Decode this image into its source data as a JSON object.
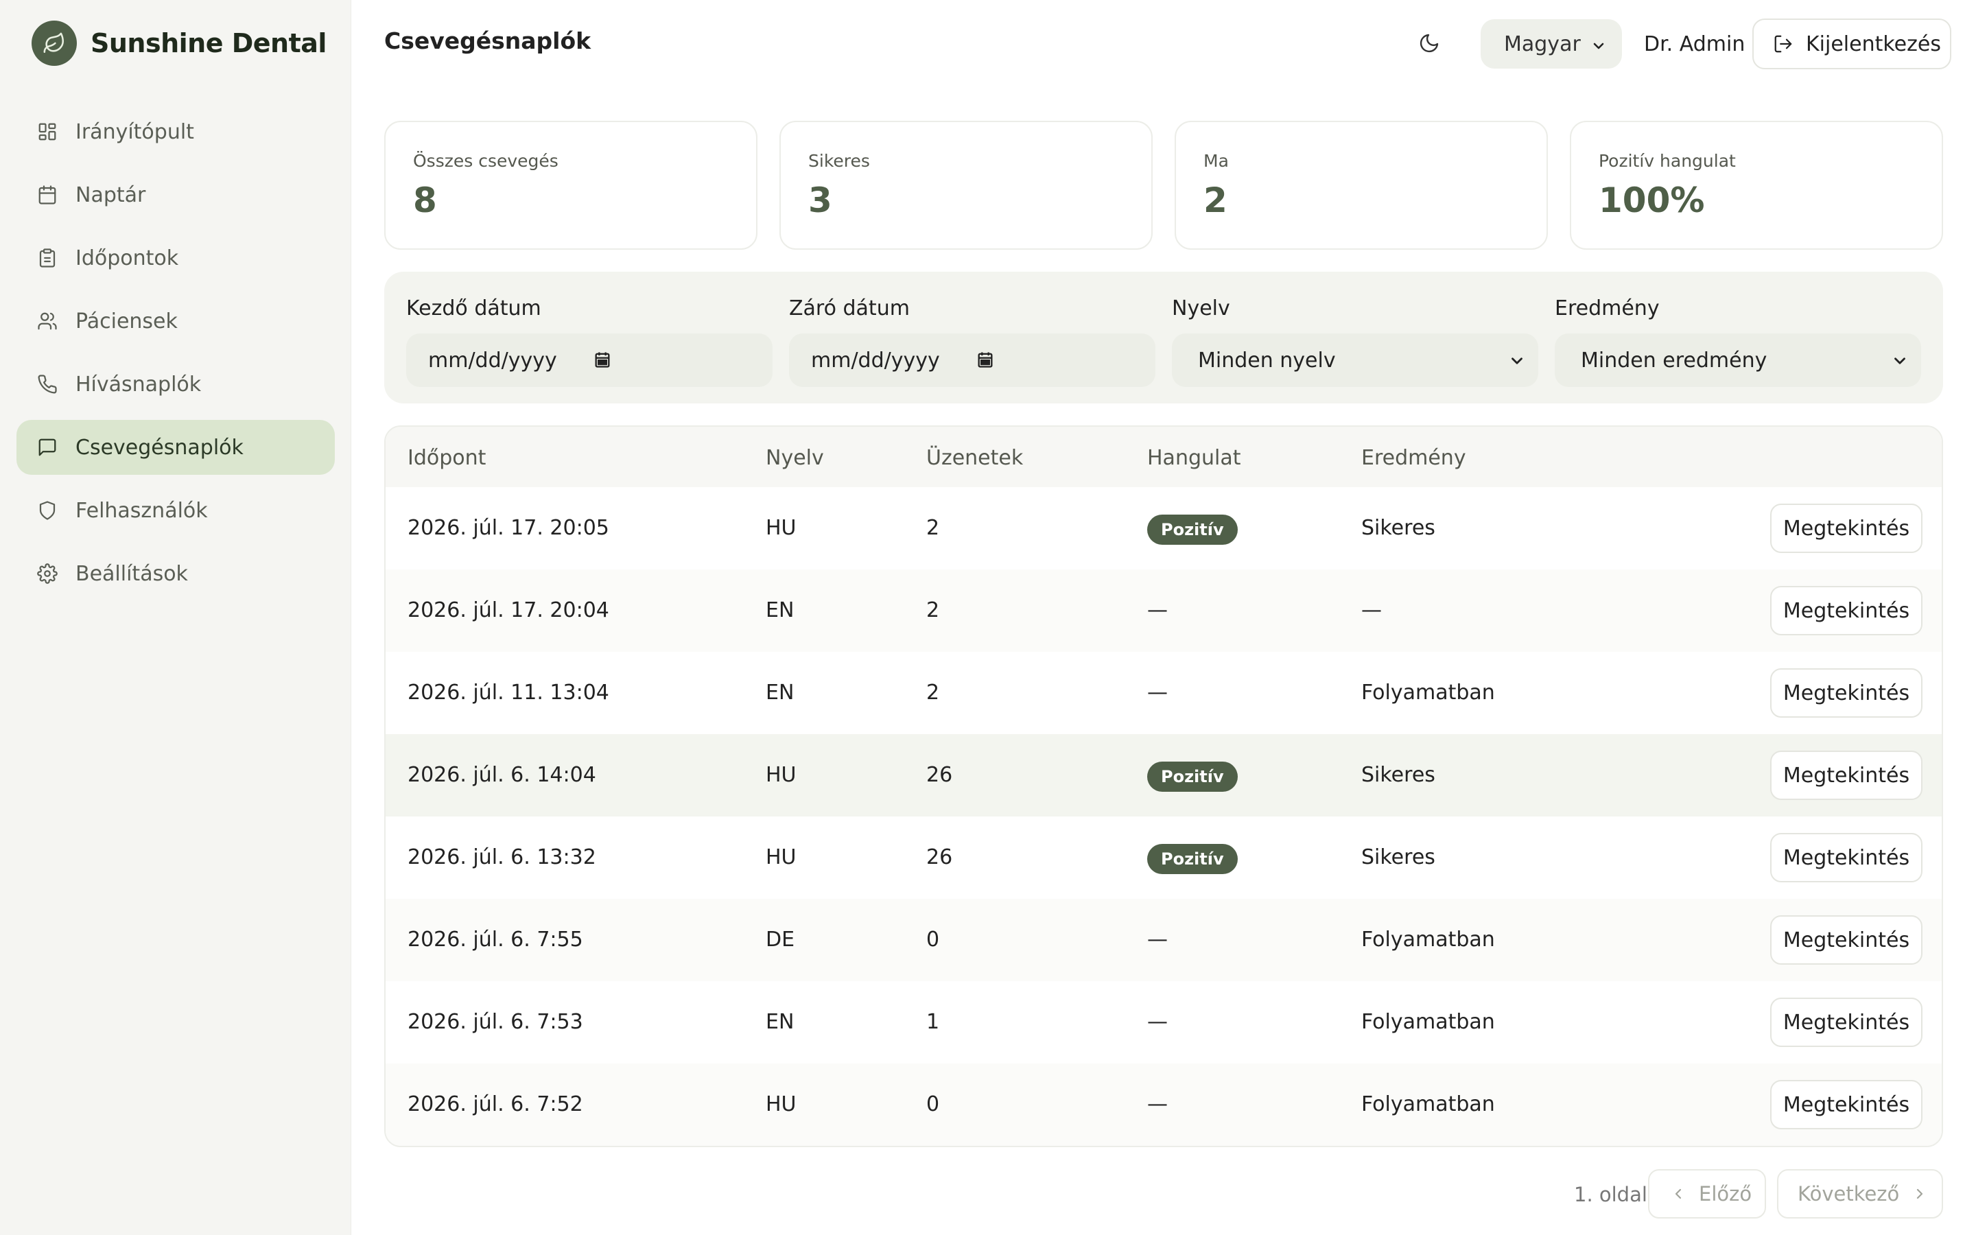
{
  "brand": {
    "name": "Sunshine Dental"
  },
  "sidebar": {
    "items": [
      {
        "label": "Irányítópult",
        "icon": "dashboard-icon",
        "active": false
      },
      {
        "label": "Naptár",
        "icon": "calendar-icon",
        "active": false
      },
      {
        "label": "Időpontok",
        "icon": "clipboard-icon",
        "active": false
      },
      {
        "label": "Páciensek",
        "icon": "users-icon",
        "active": false
      },
      {
        "label": "Hívásnaplók",
        "icon": "phone-icon",
        "active": false
      },
      {
        "label": "Csevegésnaplók",
        "icon": "chat-icon",
        "active": true
      },
      {
        "label": "Felhasználók",
        "icon": "shield-icon",
        "active": false
      },
      {
        "label": "Beállítások",
        "icon": "gear-icon",
        "active": false
      }
    ]
  },
  "header": {
    "title": "Csevegésnaplók",
    "language": "Magyar",
    "user": "Dr. Admin",
    "logout_label": "Kijelentkezés"
  },
  "stats": [
    {
      "label": "Összes csevegés",
      "value": "8"
    },
    {
      "label": "Sikeres",
      "value": "3"
    },
    {
      "label": "Ma",
      "value": "2"
    },
    {
      "label": "Pozitív hangulat",
      "value": "100%"
    }
  ],
  "filters": {
    "start_label": "Kezdő dátum",
    "start_placeholder": "mm/dd/yyyy",
    "end_label": "Záró dátum",
    "end_placeholder": "mm/dd/yyyy",
    "language_label": "Nyelv",
    "language_value": "Minden nyelv",
    "result_label": "Eredmény",
    "result_value": "Minden eredmény"
  },
  "table": {
    "headers": [
      "Időpont",
      "Nyelv",
      "Üzenetek",
      "Hangulat",
      "Eredmény"
    ],
    "view_label": "Megtekintés",
    "rows": [
      {
        "time": "2026. júl. 17. 20:05",
        "lang": "HU",
        "messages": "2",
        "sentiment": "Pozitív",
        "sentiment_badge": true,
        "result": "Sikeres"
      },
      {
        "time": "2026. júl. 17. 20:04",
        "lang": "EN",
        "messages": "2",
        "sentiment": "—",
        "sentiment_badge": false,
        "result": "—"
      },
      {
        "time": "2026. júl. 11. 13:04",
        "lang": "EN",
        "messages": "2",
        "sentiment": "—",
        "sentiment_badge": false,
        "result": "Folyamatban"
      },
      {
        "time": "2026. júl. 6. 14:04",
        "lang": "HU",
        "messages": "26",
        "sentiment": "Pozitív",
        "sentiment_badge": true,
        "result": "Sikeres"
      },
      {
        "time": "2026. júl. 6. 13:32",
        "lang": "HU",
        "messages": "26",
        "sentiment": "Pozitív",
        "sentiment_badge": true,
        "result": "Sikeres"
      },
      {
        "time": "2026. júl. 6. 7:55",
        "lang": "DE",
        "messages": "0",
        "sentiment": "—",
        "sentiment_badge": false,
        "result": "Folyamatban"
      },
      {
        "time": "2026. júl. 6. 7:53",
        "lang": "EN",
        "messages": "1",
        "sentiment": "—",
        "sentiment_badge": false,
        "result": "Folyamatban"
      },
      {
        "time": "2026. júl. 6. 7:52",
        "lang": "HU",
        "messages": "0",
        "sentiment": "—",
        "sentiment_badge": false,
        "result": "Folyamatban"
      }
    ]
  },
  "pagination": {
    "page_label": "1. oldal",
    "prev_label": "Előző",
    "next_label": "Következő"
  },
  "colors": {
    "accent": "#4f5f48",
    "active_nav": "#dbe6cf",
    "sidebar_bg": "#f5f5f2"
  }
}
